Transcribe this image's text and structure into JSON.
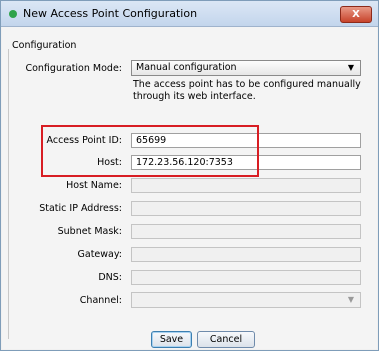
{
  "window": {
    "title": "New Access Point Configuration",
    "close_glyph": "X"
  },
  "group": {
    "label": "Configuration"
  },
  "mode": {
    "label": "Configuration Mode:",
    "value": "Manual configuration",
    "description": "The access point has to be configured manually through its web interface."
  },
  "fields": {
    "ap_id": {
      "label": "Access Point ID:",
      "value": "65699"
    },
    "host": {
      "label": "Host:",
      "value": "172.23.56.120:7353"
    },
    "hostname": {
      "label": "Host Name:",
      "value": ""
    },
    "static_ip": {
      "label": "Static IP Address:",
      "value": ""
    },
    "subnet": {
      "label": "Subnet Mask:",
      "value": ""
    },
    "gateway": {
      "label": "Gateway:",
      "value": ""
    },
    "dns": {
      "label": "DNS:",
      "value": ""
    },
    "channel": {
      "label": "Channel:",
      "value": ""
    }
  },
  "buttons": {
    "save": "Save",
    "cancel": "Cancel"
  },
  "colors": {
    "highlight": "#d81d23",
    "status_dot": "#2fa34a"
  }
}
